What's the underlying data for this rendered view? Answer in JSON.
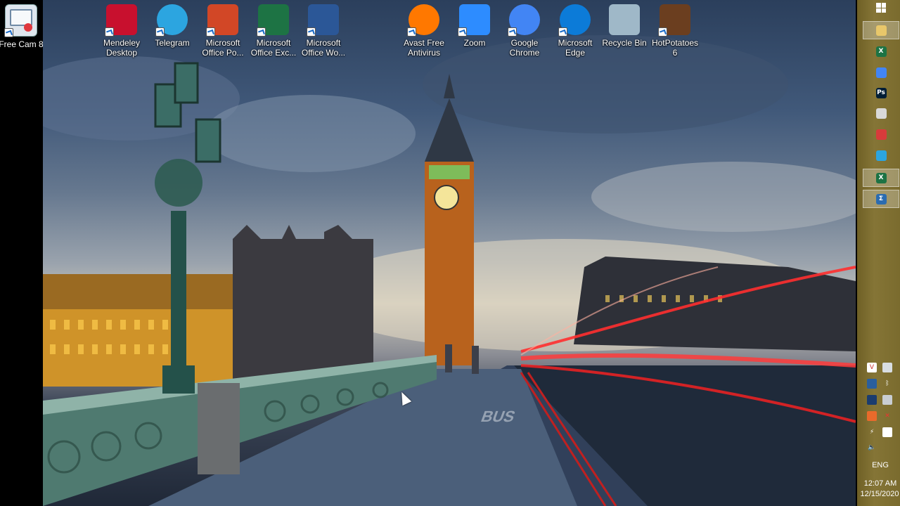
{
  "desktop": {
    "left_shortcut": {
      "label": "Free Cam 8",
      "icon": "free-cam-icon"
    },
    "icons": [
      {
        "label": "Mendeley\nDesktop",
        "icon": "mendeley-icon",
        "color": "#c8102e"
      },
      {
        "label": "Telegram",
        "icon": "telegram-icon",
        "color": "#2ca5e0"
      },
      {
        "label": "Microsoft\nOffice Po...",
        "icon": "powerpoint-icon",
        "color": "#d24726"
      },
      {
        "label": "Microsoft\nOffice Exc...",
        "icon": "excel-icon",
        "color": "#1d7344"
      },
      {
        "label": "Microsoft\nOffice Wo...",
        "icon": "word-icon",
        "color": "#2b5797"
      },
      {
        "label": "Avast Free\nAntivirus",
        "icon": "avast-icon",
        "color": "#ff7800"
      },
      {
        "label": "Zoom",
        "icon": "zoom-icon",
        "color": "#2d8cff"
      },
      {
        "label": "Google\nChrome",
        "icon": "chrome-icon",
        "color": "#4285f4"
      },
      {
        "label": "Microsoft\nEdge",
        "icon": "edge-icon",
        "color": "#0c7bd8"
      },
      {
        "label": "Recycle Bin",
        "icon": "recycle-bin-icon",
        "color": "#9fb8c8"
      },
      {
        "label": "HotPotatoes\n6",
        "icon": "hotpotatoes-icon",
        "color": "#6b3e1f"
      }
    ]
  },
  "taskbar": {
    "start": {
      "icon": "windows-start-icon"
    },
    "pinned": [
      {
        "icon": "file-explorer-icon",
        "color": "#e8c76a",
        "glyph": ""
      },
      {
        "icon": "excel-icon",
        "color": "#1d7344",
        "glyph": "X"
      },
      {
        "icon": "chrome-icon",
        "color": "#4285f4",
        "glyph": ""
      },
      {
        "icon": "photoshop-icon",
        "color": "#001e36",
        "glyph": "Ps"
      },
      {
        "icon": "paint-icon",
        "color": "#d9d9d9",
        "glyph": ""
      },
      {
        "icon": "recorder-icon",
        "color": "#d83b3b",
        "glyph": ""
      },
      {
        "icon": "telegram-icon",
        "color": "#2ca5e0",
        "glyph": ""
      },
      {
        "icon": "excel-icon",
        "color": "#1d7344",
        "glyph": "X"
      },
      {
        "icon": "math-app-icon",
        "color": "#2b6cb0",
        "glyph": "Σ"
      }
    ],
    "tray": {
      "language": "ENG",
      "time": "12:07 AM",
      "date": "12/15/2020"
    }
  }
}
